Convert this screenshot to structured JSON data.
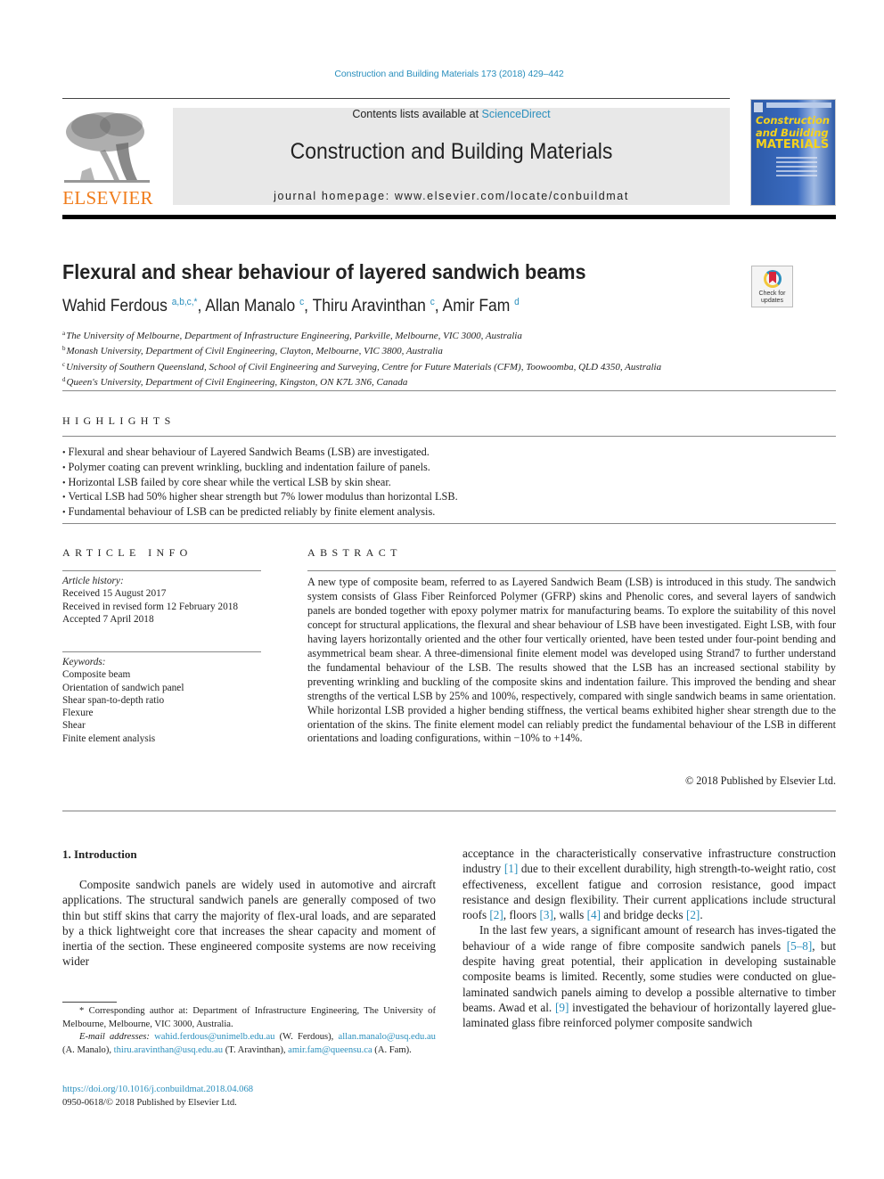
{
  "header": {
    "journal_ref": "Construction and Building Materials 173 (2018) 429–442",
    "contents_prefix": "Contents lists available at ",
    "contents_link": "ScienceDirect",
    "journal_title": "Construction and Building Materials",
    "homepage_label": "journal homepage: www.elsevier.com/locate/conbuildmat",
    "publisher_logo_text": "ELSEVIER",
    "cover": {
      "line1": "Construction",
      "line2": "and Building",
      "line3": "MATERIALS"
    },
    "colors": {
      "link": "#2a8fbd",
      "elsevier_orange": "#f07c1b",
      "cover_blue": "#2d5aa8",
      "cover_yellow": "#f5d21c"
    }
  },
  "article": {
    "title": "Flexural and shear behaviour of layered sandwich beams",
    "check_updates": {
      "line1": "Check for",
      "line2": "updates"
    },
    "authors": [
      {
        "name": "Wahid Ferdous",
        "sup": "a,b,c,",
        "corresponding": "*",
        "sep": ", "
      },
      {
        "name": "Allan Manalo",
        "sup": "c",
        "corresponding": "",
        "sep": ", "
      },
      {
        "name": "Thiru Aravinthan",
        "sup": "c",
        "corresponding": "",
        "sep": ", "
      },
      {
        "name": "Amir Fam",
        "sup": "d",
        "corresponding": "",
        "sep": ""
      }
    ],
    "affiliations": [
      {
        "key": "a",
        "text": "The University of Melbourne, Department of Infrastructure Engineering, Parkville, Melbourne, VIC 3000, Australia"
      },
      {
        "key": "b",
        "text": "Monash University, Department of Civil Engineering, Clayton, Melbourne, VIC 3800, Australia"
      },
      {
        "key": "c",
        "text": "University of Southern Queensland, School of Civil Engineering and Surveying, Centre for Future Materials (CFM), Toowoomba, QLD 4350, Australia"
      },
      {
        "key": "d",
        "text": "Queen's University, Department of Civil Engineering, Kingston, ON K7L 3N6, Canada"
      }
    ]
  },
  "highlights": {
    "label": "HIGHLIGHTS",
    "items": [
      "Flexural and shear behaviour of Layered Sandwich Beams (LSB) are investigated.",
      "Polymer coating can prevent wrinkling, buckling and indentation failure of panels.",
      "Horizontal LSB failed by core shear while the vertical LSB by skin shear.",
      "Vertical LSB had 50% higher shear strength but 7% lower modulus than horizontal LSB.",
      "Fundamental behaviour of LSB can be predicted reliably by finite element analysis."
    ]
  },
  "article_info": {
    "label": "ARTICLE INFO",
    "history_label": "Article history:",
    "history": [
      "Received 15 August 2017",
      "Received in revised form 12 February 2018",
      "Accepted 7 April 2018"
    ],
    "keywords_label": "Keywords:",
    "keywords": [
      "Composite beam",
      "Orientation of sandwich panel",
      "Shear span-to-depth ratio",
      "Flexure",
      "Shear",
      "Finite element analysis"
    ]
  },
  "abstract": {
    "label": "ABSTRACT",
    "text": "A new type of composite beam, referred to as Layered Sandwich Beam (LSB) is introduced in this study. The sandwich system consists of Glass Fiber Reinforced Polymer (GFRP) skins and Phenolic cores, and several layers of sandwich panels are bonded together with epoxy polymer matrix for manufacturing beams. To explore the suitability of this novel concept for structural applications, the flexural and shear behaviour of LSB have been investigated. Eight LSB, with four having layers horizontally oriented and the other four vertically oriented, have been tested under four-point bending and asymmetrical beam shear. A three-dimensional finite element model was developed using Strand7 to further understand the fundamental behaviour of the LSB. The results showed that the LSB has an increased sectional stability by preventing wrinkling and buckling of the composite skins and indentation failure. This improved the bending and shear strengths of the vertical LSB by 25% and 100%, respectively, compared with single sandwich beams in same orientation. While horizontal LSB provided a higher bending stiffness, the vertical beams exhibited higher shear strength due to the orientation of the skins. The finite element model can reliably predict the fundamental behaviour of the LSB in different orientations and loading configurations, within −10% to +14%.",
    "copyright": "© 2018 Published by Elsevier Ltd."
  },
  "introduction": {
    "heading": "1. Introduction",
    "left_para": "Composite sandwich panels are widely used in automotive and aircraft applications. The structural sandwich panels are generally composed of two thin but stiff skins that carry the majority of flex-ural loads, and are separated by a thick lightweight core that increases the shear capacity and moment of inertia of the section. These engineered composite systems are now receiving wider",
    "right_para1": [
      {
        "t": "acceptance in the characteristically conservative infrastructure construction industry "
      },
      {
        "t": "[1]",
        "ref": true
      },
      {
        "t": " due to their excellent durability, high strength-to-weight ratio, cost effectiveness, excellent fatigue and corrosion resistance, good impact resistance and design flexibility. Their current applications include structural roofs "
      },
      {
        "t": "[2]",
        "ref": true
      },
      {
        "t": ", floors "
      },
      {
        "t": "[3]",
        "ref": true
      },
      {
        "t": ", walls "
      },
      {
        "t": "[4]",
        "ref": true
      },
      {
        "t": " and bridge decks "
      },
      {
        "t": "[2]",
        "ref": true
      },
      {
        "t": "."
      }
    ],
    "right_para2": [
      {
        "t": "In the last few years, a significant amount of research has inves-tigated the behaviour of a wide range of fibre composite sandwich panels "
      },
      {
        "t": "[5–8]",
        "ref": true
      },
      {
        "t": ", but despite having great potential, their application in developing sustainable composite beams is limited. Recently, some studies were conducted on glue-laminated sandwich panels aiming to develop a possible alternative to timber beams. Awad et al. "
      },
      {
        "t": "[9]",
        "ref": true
      },
      {
        "t": " investigated the behaviour of horizontally layered glue-laminated glass fibre reinforced polymer composite sandwich"
      }
    ]
  },
  "footnote": {
    "corresponding": "* Corresponding author at: Department of Infrastructure Engineering, The University of Melbourne, Melbourne, VIC 3000, Australia.",
    "email_label": "E-mail addresses:",
    "emails": [
      {
        "addr": "wahid.ferdous@unimelb.edu.au",
        "who": " (W. Ferdous), "
      },
      {
        "addr": "allan.manalo@usq.edu.au",
        "who": " (A. Manalo), "
      },
      {
        "addr": "thiru.aravinthan@usq.edu.au",
        "who": " (T. Aravinthan), "
      },
      {
        "addr": "amir.fam@queensu.ca",
        "who": " (A. Fam)."
      }
    ],
    "doi": "https://doi.org/10.1016/j.conbuildmat.2018.04.068",
    "issn": "0950-0618/© 2018 Published by Elsevier Ltd."
  }
}
